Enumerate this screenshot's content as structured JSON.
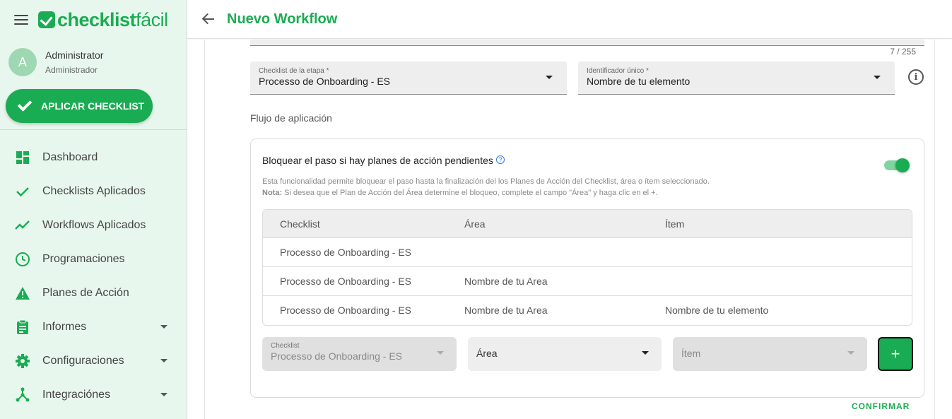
{
  "app": {
    "logo_bold": "checklist",
    "logo_light": "fácil"
  },
  "user": {
    "initial": "A",
    "name": "Administrator",
    "role": "Administrador"
  },
  "sidebar": {
    "apply_button": "APLICAR CHECKLIST",
    "items": [
      {
        "label": "Dashboard",
        "icon": "dashboard-icon"
      },
      {
        "label": "Checklists Aplicados",
        "icon": "check-icon"
      },
      {
        "label": "Workflows Aplicados",
        "icon": "trending-icon"
      },
      {
        "label": "Programaciones",
        "icon": "clock-icon"
      },
      {
        "label": "Planes de Acción",
        "icon": "warning-icon"
      },
      {
        "label": "Informes",
        "icon": "clipboard-icon",
        "expandable": true
      },
      {
        "label": "Configuraciones",
        "icon": "gear-icon",
        "expandable": true
      },
      {
        "label": "Integraciónes",
        "icon": "hub-icon",
        "expandable": true
      }
    ]
  },
  "header": {
    "title": "Nuevo Workflow"
  },
  "form": {
    "counter": "7 / 255",
    "checklist_select": {
      "label": "Checklist de la etapa *",
      "value": "Processo de Onboarding - ES"
    },
    "identifier_select": {
      "label": "Identificador único *",
      "value": "Nombre de tu elemento"
    },
    "flow_label": "Flujo de aplicación"
  },
  "block_card": {
    "title": "Bloquear el paso si hay planes de acción pendientes",
    "toggle_on": true,
    "description": "Esta funcionalidad permite bloquear el paso hasta la finalización del los Planes de Acción del Checklist, área o ítem seleccionado.",
    "note_label": "Nota:",
    "note_text": " Si desea que el Plan de Acción del Área determine el bloqueo, complete el campo \"Área\" y haga clic en el +.",
    "table": {
      "headers": [
        "Checklist",
        "Área",
        "Ítem"
      ],
      "rows": [
        [
          "Processo de Onboarding - ES",
          "",
          ""
        ],
        [
          "Processo de Onboarding - ES",
          "Nombre de tu Area",
          ""
        ],
        [
          "Processo de Onboarding - ES",
          "Nombre de tu Area",
          "Nombre de tu elemento"
        ]
      ]
    },
    "add_row": {
      "checklist_label": "Checklist",
      "checklist_value": "Processo de Onboarding - ES",
      "area_placeholder": "Área",
      "item_placeholder": "Ítem",
      "add_button": "+"
    }
  },
  "footer": {
    "confirm": "CONFIRMAR"
  },
  "colors": {
    "brand": "#1aac52",
    "sidebar_bg": "#e8f7ee"
  }
}
